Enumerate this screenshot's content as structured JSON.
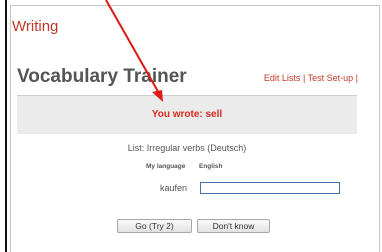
{
  "section_title": "Writing",
  "app_title": "Vocabulary Trainer",
  "top_links": {
    "edit_lists": "Edit Lists",
    "separator": " | ",
    "test_setup": "Test Set-up",
    "trailing": " |"
  },
  "feedback": "You wrote: sell",
  "list_line": "List: Irregular verbs (Deutsch)",
  "columns": {
    "my_language": "My language",
    "english": "English"
  },
  "word": "kaufen",
  "answer": {
    "value": "",
    "placeholder": ""
  },
  "buttons": {
    "go": "Go (Try 2)",
    "dont_know": "Don't know"
  },
  "colors": {
    "accent_red": "#d62a1f",
    "title_gray": "#555555",
    "feedback_bg": "#ebebeb",
    "input_border": "#4a6fa5"
  }
}
